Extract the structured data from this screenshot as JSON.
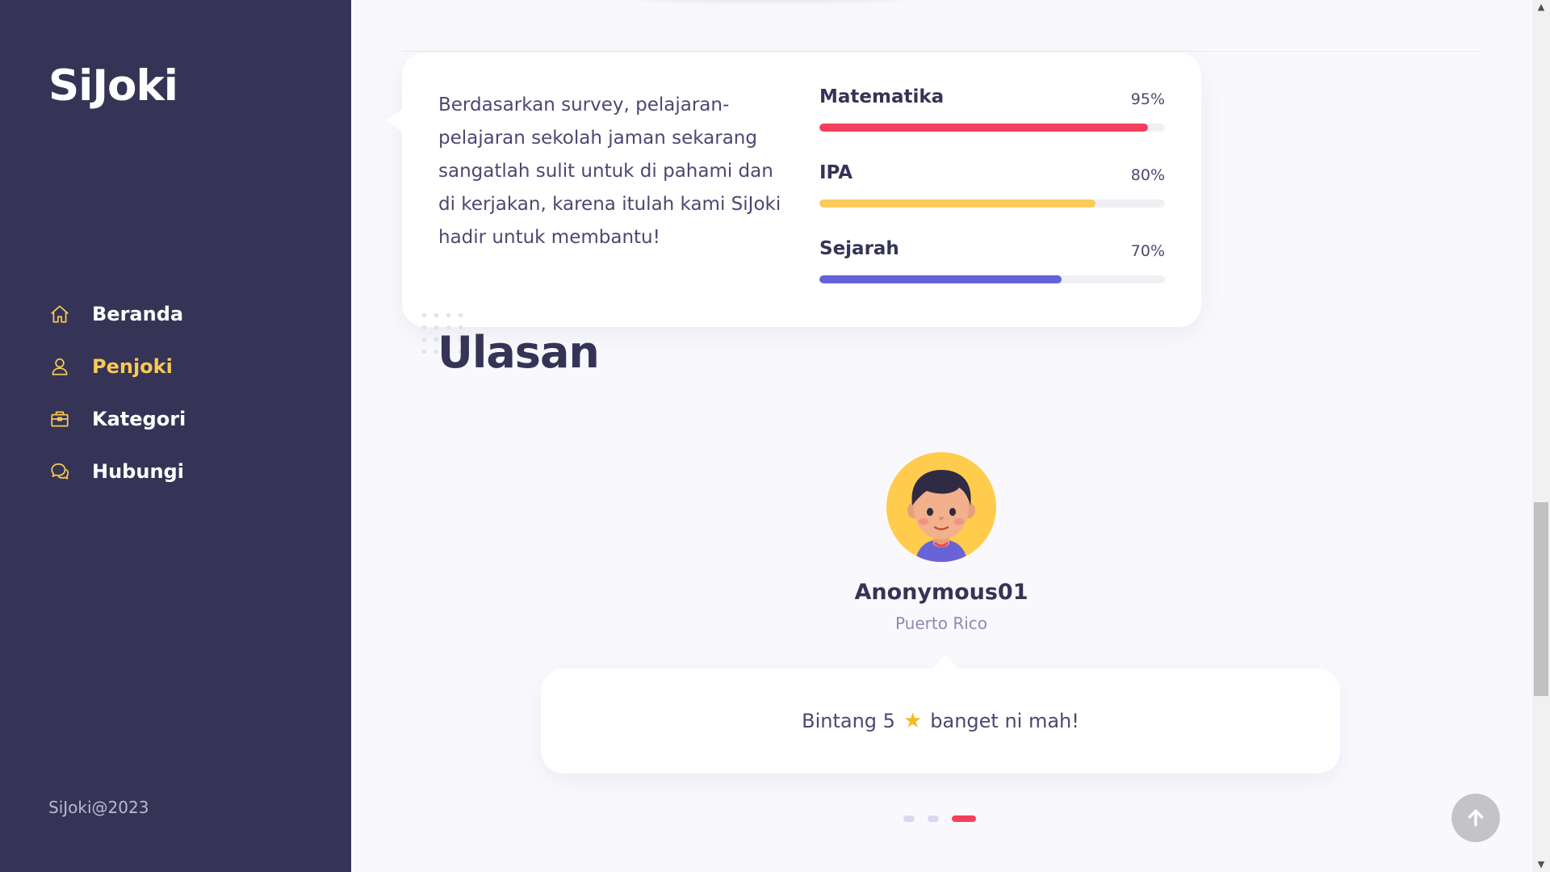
{
  "sidebar": {
    "brand": "SiJoki",
    "nav": [
      {
        "label": "Beranda",
        "icon": "home-icon"
      },
      {
        "label": "Penjoki",
        "icon": "user-icon"
      },
      {
        "label": "Kategori",
        "icon": "briefcase-icon"
      },
      {
        "label": "Hubungi",
        "icon": "chat-icon"
      }
    ],
    "active_item": "Penjoki",
    "copyright": "SiJoki@2023"
  },
  "skills": {
    "description": "Berdasarkan survey, pelajaran-pelajaran sekolah jaman sekarang sangatlah sulit untuk di pahami dan di kerjakan, karena itulah kami SiJoki hadir untuk membantu!",
    "items": [
      {
        "name": "Matematika",
        "percent_label": "95%",
        "value": 95,
        "color": "#f43f5e"
      },
      {
        "name": "IPA",
        "percent_label": "80%",
        "value": 80,
        "color": "#fdcb57"
      },
      {
        "name": "Sejarah",
        "percent_label": "70%",
        "value": 70,
        "color": "#6562d6"
      }
    ]
  },
  "reviews": {
    "title": "Ulasan",
    "name": "Anonymous01",
    "location": "Puerto Rico",
    "text_before": "Bintang 5",
    "text_after": "banget ni mah!",
    "pager": {
      "count": 3,
      "active": 3
    }
  },
  "colors": {
    "sidebar_bg": "#353456",
    "accent_yellow": "#f7c955",
    "accent_red": "#f43f5e"
  }
}
